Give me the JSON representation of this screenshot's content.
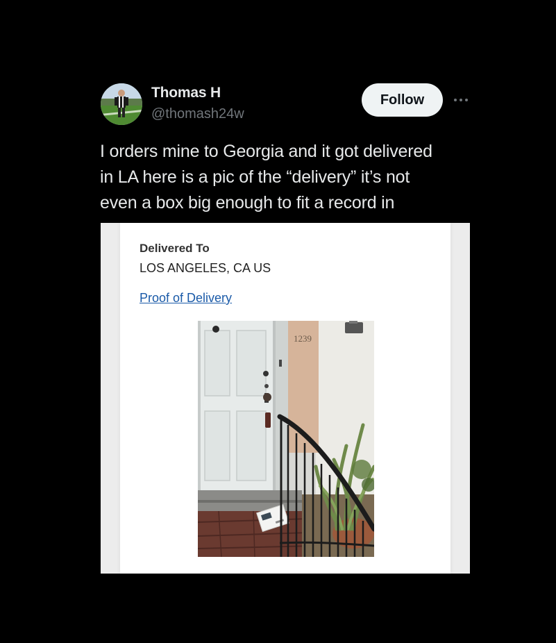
{
  "author": {
    "name": "Thomas H",
    "handle": "@thomash24w",
    "avatar_icon": "avatar-photo-icon"
  },
  "actions": {
    "follow_label": "Follow",
    "more_icon": "more-options-icon"
  },
  "tweet": {
    "text_lines": [
      "I orders mine to Georgia and it got delivered",
      "in LA here is a pic of the “delivery” it’s not",
      "even a box big enough to fit a record in"
    ]
  },
  "media": {
    "delivered_to_label": "Delivered To",
    "delivered_to_value": "LOS ANGELES, CA US",
    "proof_link": "Proof of Delivery",
    "photo_house_number": "1239"
  },
  "colors": {
    "background": "#000000",
    "text_primary": "#e7e9ea",
    "text_secondary": "#71767b",
    "follow_bg": "#eff3f4",
    "link": "#1a5aa8"
  }
}
